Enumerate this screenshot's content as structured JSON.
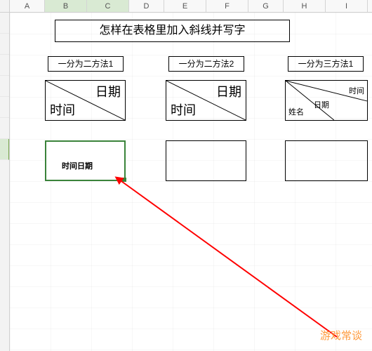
{
  "columns": {
    "A": "A",
    "B": "B",
    "C": "C",
    "D": "D",
    "E": "E",
    "F": "F",
    "G": "G",
    "H": "H",
    "I": "I"
  },
  "title": "怎样在表格里加入斜线并写字",
  "methods": {
    "m1": "一分为二方法1",
    "m2": "一分为二方法2",
    "m3": "一分为三方法1"
  },
  "diag": {
    "date": "日期",
    "time": "时间",
    "name": "姓名"
  },
  "active_text": "时间日期",
  "watermark": "游戏常谈"
}
